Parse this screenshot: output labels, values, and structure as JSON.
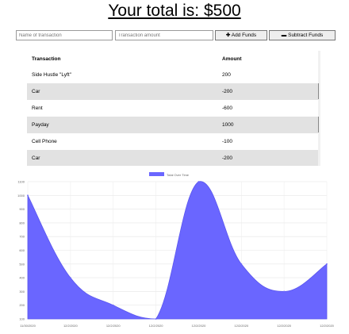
{
  "header": {
    "title": "Your total is: $500"
  },
  "form": {
    "name_placeholder": "Name of transaction",
    "amount_placeholder": "Transaction amount",
    "add_label": "Add Funds",
    "subtract_label": "Subtract Funds"
  },
  "table": {
    "headers": [
      "Transaction",
      "Amount"
    ],
    "rows": [
      [
        "Side Hustle \"Lyft\"",
        "200"
      ],
      [
        "Car",
        "-200"
      ],
      [
        "Rent",
        "-600"
      ],
      [
        "Payday",
        "1000"
      ],
      [
        "Cell Phone",
        "-100"
      ],
      [
        "Car",
        "-200"
      ]
    ]
  },
  "colors": {
    "series_fill": "#6a66ff",
    "row_alt": "#e2e2e2"
  },
  "chart_data": {
    "type": "area",
    "legend": [
      "Total Over Time"
    ],
    "legend_position": "top",
    "x": [
      "11/30/2020",
      "12/2/2020",
      "12/2/2020",
      "12/2/2020",
      "12/2/2020",
      "12/2/2020",
      "12/2/2020",
      "12/2/2020"
    ],
    "series": [
      {
        "name": "Total Over Time",
        "values": [
          1000,
          400,
          200,
          100,
          1100,
          500,
          300,
          500
        ]
      }
    ],
    "ylim": [
      100,
      1100
    ],
    "yticks": [
      "1100",
      "1000",
      "900",
      "800",
      "700",
      "600",
      "500",
      "400",
      "300",
      "200",
      "100"
    ],
    "grid": true
  }
}
